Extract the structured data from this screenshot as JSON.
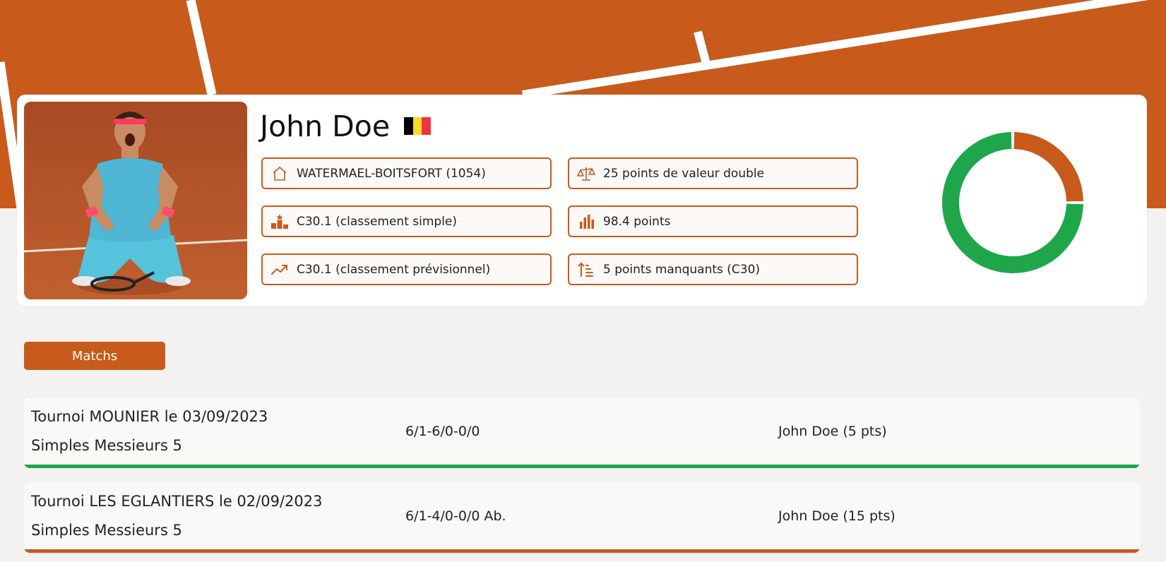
{
  "theme": {
    "primary": "#c85a1b",
    "win": "#1fa64b",
    "loss": "#c85a1b",
    "court_lines": "#ffffff"
  },
  "player": {
    "name": "John Doe",
    "flag_colors": [
      "#000000",
      "#fdda24",
      "#ef3340"
    ],
    "info": [
      {
        "icon": "home-icon",
        "text": "WATERMAEL-BOITSFORT (1054)"
      },
      {
        "icon": "scale-icon",
        "text": "25 points de valeur double"
      },
      {
        "icon": "podium-icon",
        "text": "C30.1 (classement simple)"
      },
      {
        "icon": "bar-chart-icon",
        "text": "98.4 points"
      },
      {
        "icon": "trending-up-icon",
        "text": "C30.1 (classement prévisionnel)"
      },
      {
        "icon": "sort-ascending-icon",
        "text": "5 points manquants (C30)"
      }
    ]
  },
  "chart_data": {
    "type": "pie",
    "variant": "donut",
    "values": [
      75,
      25
    ],
    "colors": [
      "#1fa64b",
      "#c85a1b"
    ]
  },
  "tabs": {
    "matches_label": "Matchs"
  },
  "matches": [
    {
      "tournament": "Tournoi MOUNIER le 03/09/2023",
      "category": "Simples Messieurs 5",
      "score": "6/1-6/0-0/0",
      "winner": "John Doe (5 pts)",
      "result": "win"
    },
    {
      "tournament": "Tournoi LES EGLANTIERS le 02/09/2023",
      "category": "Simples Messieurs 5",
      "score": "6/1-4/0-0/0 Ab.",
      "winner": "John Doe (15 pts)",
      "result": "loss"
    }
  ]
}
